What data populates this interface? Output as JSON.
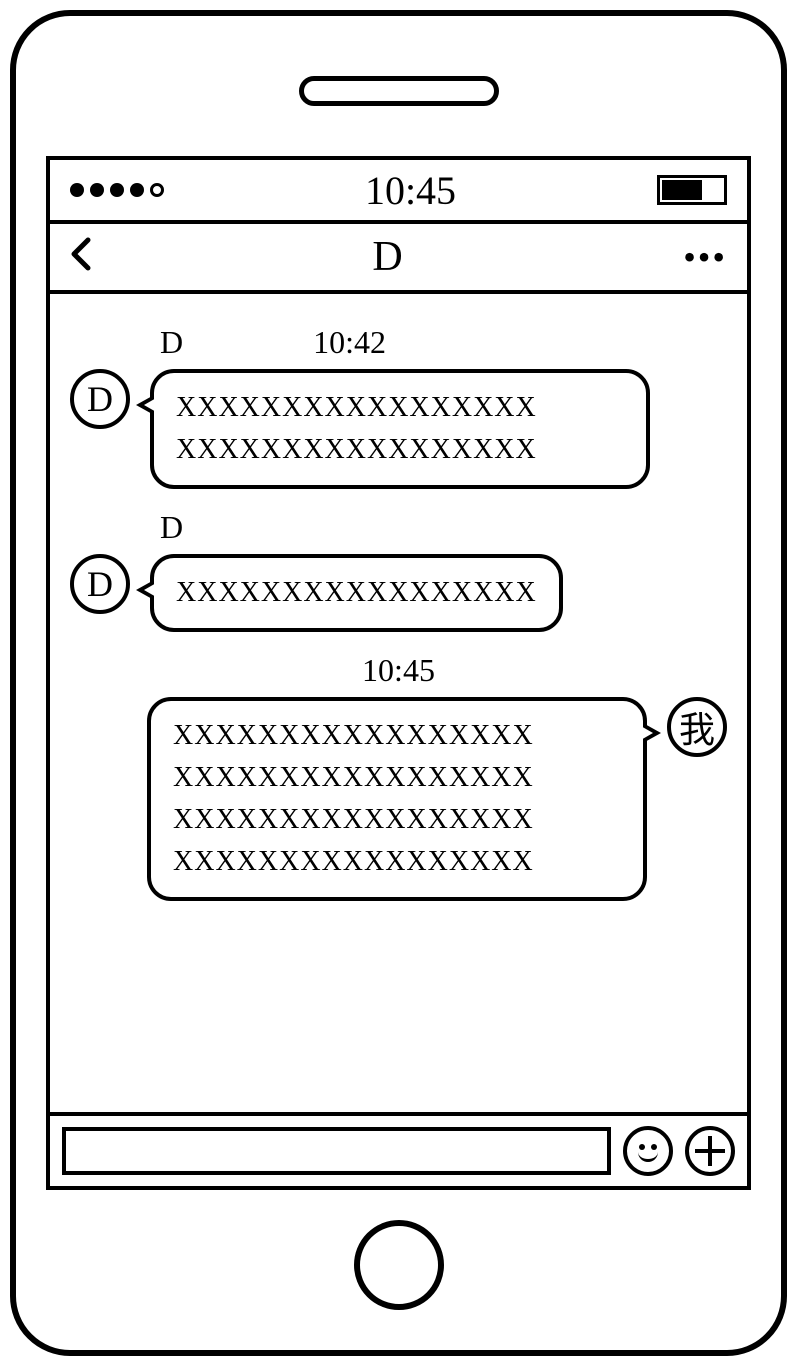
{
  "statusBar": {
    "time": "10:45"
  },
  "navBar": {
    "title": "D"
  },
  "messages": [
    {
      "sender": "D",
      "avatar": "D",
      "timestamp": "10:42",
      "side": "left",
      "text": "XXXXXXXXXXXXXXXXX XXXXXXXXXXXXXXXXX"
    },
    {
      "sender": "D",
      "avatar": "D",
      "timestamp": "",
      "side": "left",
      "text": "XXXXXXXXXXXXXXXXX"
    },
    {
      "sender": "我",
      "avatar": "我",
      "timestamp": "10:45",
      "side": "right",
      "text": "XXXXXXXXXXXXXXXXX XXXXXXXXXXXXXXXXX XXXXXXXXXXXXXXXXX XXXXXXXXXXXXXXXXX"
    }
  ],
  "inputBar": {
    "placeholder": ""
  }
}
